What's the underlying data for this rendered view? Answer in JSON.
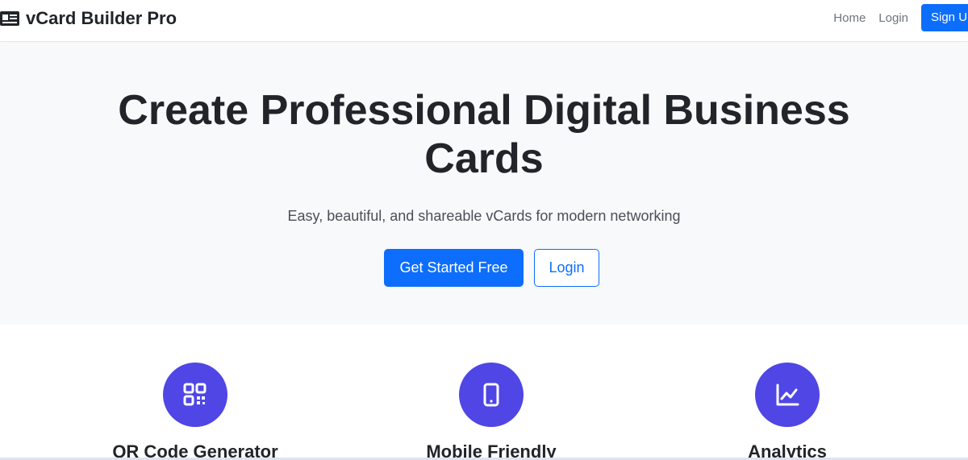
{
  "navbar": {
    "brand_icon": "id-card-icon",
    "brand": "vCard Builder Pro",
    "links": [
      {
        "label": "Home"
      },
      {
        "label": "Login"
      }
    ],
    "signup_label": "Sign U"
  },
  "hero": {
    "title": "Create Professional Digital Business Cards",
    "subtitle": "Easy, beautiful, and shareable vCards for modern networking",
    "primary_button": "Get Started Free",
    "secondary_button": "Login"
  },
  "features": [
    {
      "icon": "qr-code-icon",
      "title": "QR Code Generator"
    },
    {
      "icon": "mobile-phone-icon",
      "title": "Mobile Friendly"
    },
    {
      "icon": "line-chart-icon",
      "title": "Analytics"
    }
  ],
  "colors": {
    "primary": "#0d6efd",
    "feature_accent": "#4f46e5",
    "hero_bg": "#f8f9fa"
  }
}
